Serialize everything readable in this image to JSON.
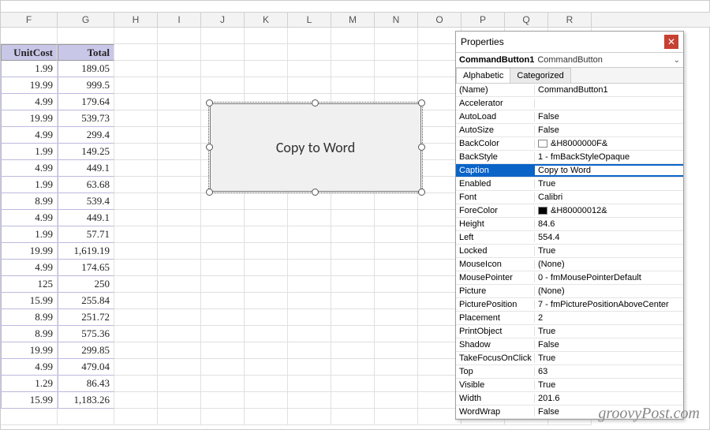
{
  "columns": [
    "F",
    "G",
    "H",
    "I",
    "J",
    "K",
    "L",
    "M",
    "N",
    "O",
    "P",
    "Q",
    "R"
  ],
  "table": {
    "headers": {
      "unitcost": "UnitCost",
      "total": "Total"
    },
    "rows": [
      {
        "unitcost": "1.99",
        "total": "189.05"
      },
      {
        "unitcost": "19.99",
        "total": "999.5"
      },
      {
        "unitcost": "4.99",
        "total": "179.64"
      },
      {
        "unitcost": "19.99",
        "total": "539.73"
      },
      {
        "unitcost": "4.99",
        "total": "299.4"
      },
      {
        "unitcost": "1.99",
        "total": "149.25"
      },
      {
        "unitcost": "4.99",
        "total": "449.1"
      },
      {
        "unitcost": "1.99",
        "total": "63.68"
      },
      {
        "unitcost": "8.99",
        "total": "539.4"
      },
      {
        "unitcost": "4.99",
        "total": "449.1"
      },
      {
        "unitcost": "1.99",
        "total": "57.71"
      },
      {
        "unitcost": "19.99",
        "total": "1,619.19"
      },
      {
        "unitcost": "4.99",
        "total": "174.65"
      },
      {
        "unitcost": "125",
        "total": "250"
      },
      {
        "unitcost": "15.99",
        "total": "255.84"
      },
      {
        "unitcost": "8.99",
        "total": "251.72"
      },
      {
        "unitcost": "8.99",
        "total": "575.36"
      },
      {
        "unitcost": "19.99",
        "total": "299.85"
      },
      {
        "unitcost": "4.99",
        "total": "479.04"
      },
      {
        "unitcost": "1.29",
        "total": "86.43"
      },
      {
        "unitcost": "15.99",
        "total": "1,183.26"
      }
    ]
  },
  "button": {
    "caption": "Copy to Word"
  },
  "properties_panel": {
    "title": "Properties",
    "object": {
      "name": "CommandButton1",
      "type": "CommandButton"
    },
    "tabs": {
      "alphabetic": "Alphabetic",
      "categorized": "Categorized"
    },
    "selected_property": "Caption",
    "rows": [
      {
        "name": "(Name)",
        "value": "CommandButton1"
      },
      {
        "name": "Accelerator",
        "value": ""
      },
      {
        "name": "AutoLoad",
        "value": "False"
      },
      {
        "name": "AutoSize",
        "value": "False"
      },
      {
        "name": "BackColor",
        "value": "&H8000000F&",
        "swatch": "white"
      },
      {
        "name": "BackStyle",
        "value": "1 - fmBackStyleOpaque"
      },
      {
        "name": "Caption",
        "value": "Copy to Word"
      },
      {
        "name": "Enabled",
        "value": "True"
      },
      {
        "name": "Font",
        "value": "Calibri"
      },
      {
        "name": "ForeColor",
        "value": "&H80000012&",
        "swatch": "black"
      },
      {
        "name": "Height",
        "value": "84.6"
      },
      {
        "name": "Left",
        "value": "554.4"
      },
      {
        "name": "Locked",
        "value": "True"
      },
      {
        "name": "MouseIcon",
        "value": "(None)"
      },
      {
        "name": "MousePointer",
        "value": "0 - fmMousePointerDefault"
      },
      {
        "name": "Picture",
        "value": "(None)"
      },
      {
        "name": "PicturePosition",
        "value": "7 - fmPicturePositionAboveCenter"
      },
      {
        "name": "Placement",
        "value": "2"
      },
      {
        "name": "PrintObject",
        "value": "True"
      },
      {
        "name": "Shadow",
        "value": "False"
      },
      {
        "name": "TakeFocusOnClick",
        "value": "True"
      },
      {
        "name": "Top",
        "value": "63"
      },
      {
        "name": "Visible",
        "value": "True"
      },
      {
        "name": "Width",
        "value": "201.6"
      },
      {
        "name": "WordWrap",
        "value": "False"
      }
    ]
  },
  "watermark": "groovyPost.com"
}
